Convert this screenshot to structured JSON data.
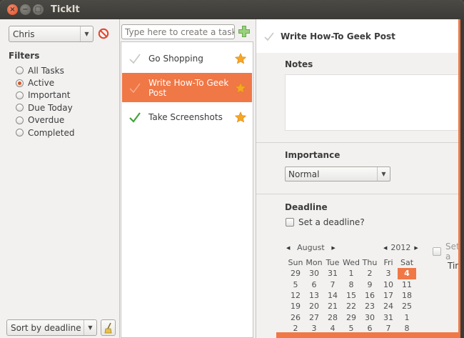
{
  "window": {
    "title": "TickIt"
  },
  "sidebar": {
    "user": "Chris",
    "filters_title": "Filters",
    "filters": [
      {
        "label": "All Tasks",
        "selected": false
      },
      {
        "label": "Active",
        "selected": true
      },
      {
        "label": "Important",
        "selected": false
      },
      {
        "label": "Due Today",
        "selected": false
      },
      {
        "label": "Overdue",
        "selected": false
      },
      {
        "label": "Completed",
        "selected": false
      }
    ],
    "sort": "Sort by deadline"
  },
  "tasks": {
    "placeholder": "Type here to create a task...",
    "items": [
      {
        "label": "Go Shopping",
        "done": false,
        "starred": true,
        "selected": false
      },
      {
        "label": "Write How-To Geek Post",
        "done": false,
        "starred": true,
        "selected": true
      },
      {
        "label": "Take Screenshots",
        "done": true,
        "starred": true,
        "selected": false
      }
    ]
  },
  "details": {
    "title": "Write How-To Geek Post",
    "notes_label": "Notes",
    "importance_label": "Importance",
    "importance_value": "Normal",
    "deadline_label": "Deadline",
    "set_deadline": "Set a deadline?",
    "calendar": {
      "month": "August",
      "year": "2012",
      "weekdays": [
        "Sun",
        "Mon",
        "Tue",
        "Wed",
        "Thu",
        "Fri",
        "Sat"
      ],
      "weeks": [
        [
          "29",
          "30",
          "31",
          "1",
          "2",
          "3",
          "4"
        ],
        [
          "5",
          "6",
          "7",
          "8",
          "9",
          "10",
          "11"
        ],
        [
          "12",
          "13",
          "14",
          "15",
          "16",
          "17",
          "18"
        ],
        [
          "19",
          "20",
          "21",
          "22",
          "23",
          "24",
          "25"
        ],
        [
          "26",
          "27",
          "28",
          "29",
          "30",
          "31",
          "1"
        ],
        [
          "2",
          "3",
          "4",
          "5",
          "6",
          "7",
          "8"
        ]
      ],
      "highlighted": "4"
    },
    "set_a_partial": "Set a",
    "tim_partial": "Tim"
  },
  "colors": {
    "accent": "#f07746",
    "titlebar": "#3c3b37",
    "check_green": "#3fa53a",
    "star": "#f5a623"
  }
}
